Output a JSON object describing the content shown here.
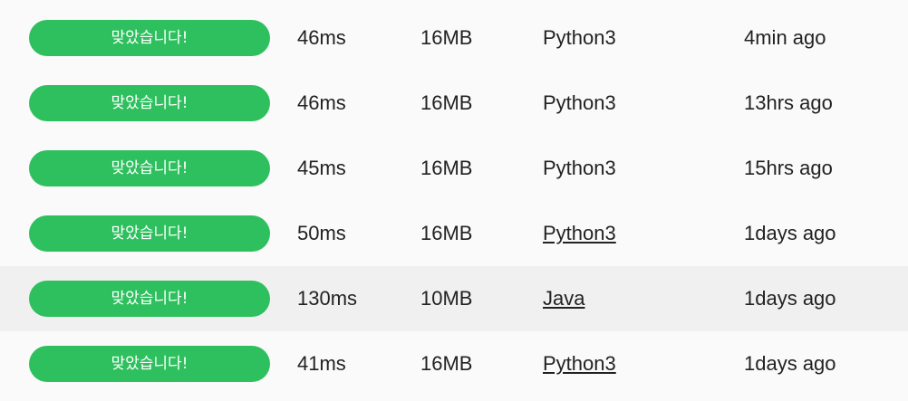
{
  "submissions": [
    {
      "result": "맞았습니다!",
      "time": "46ms",
      "memory": "16MB",
      "language": "Python3",
      "language_link": false,
      "submitted": "4min ago"
    },
    {
      "result": "맞았습니다!",
      "time": "46ms",
      "memory": "16MB",
      "language": "Python3",
      "language_link": false,
      "submitted": "13hrs ago"
    },
    {
      "result": "맞았습니다!",
      "time": "45ms",
      "memory": "16MB",
      "language": "Python3",
      "language_link": false,
      "submitted": "15hrs ago"
    },
    {
      "result": "맞았습니다!",
      "time": "50ms",
      "memory": "16MB",
      "language": "Python3",
      "language_link": true,
      "submitted": "1days ago"
    },
    {
      "result": "맞았습니다!",
      "time": "130ms",
      "memory": "10MB",
      "language": "Java",
      "language_link": true,
      "submitted": "1days ago",
      "highlighted": true
    },
    {
      "result": "맞았습니다!",
      "time": "41ms",
      "memory": "16MB",
      "language": "Python3",
      "language_link": true,
      "submitted": "1days ago"
    }
  ],
  "colors": {
    "accepted_badge": "#2ec05e",
    "row_highlight": "#f0f0f0",
    "background": "#fafafa"
  }
}
